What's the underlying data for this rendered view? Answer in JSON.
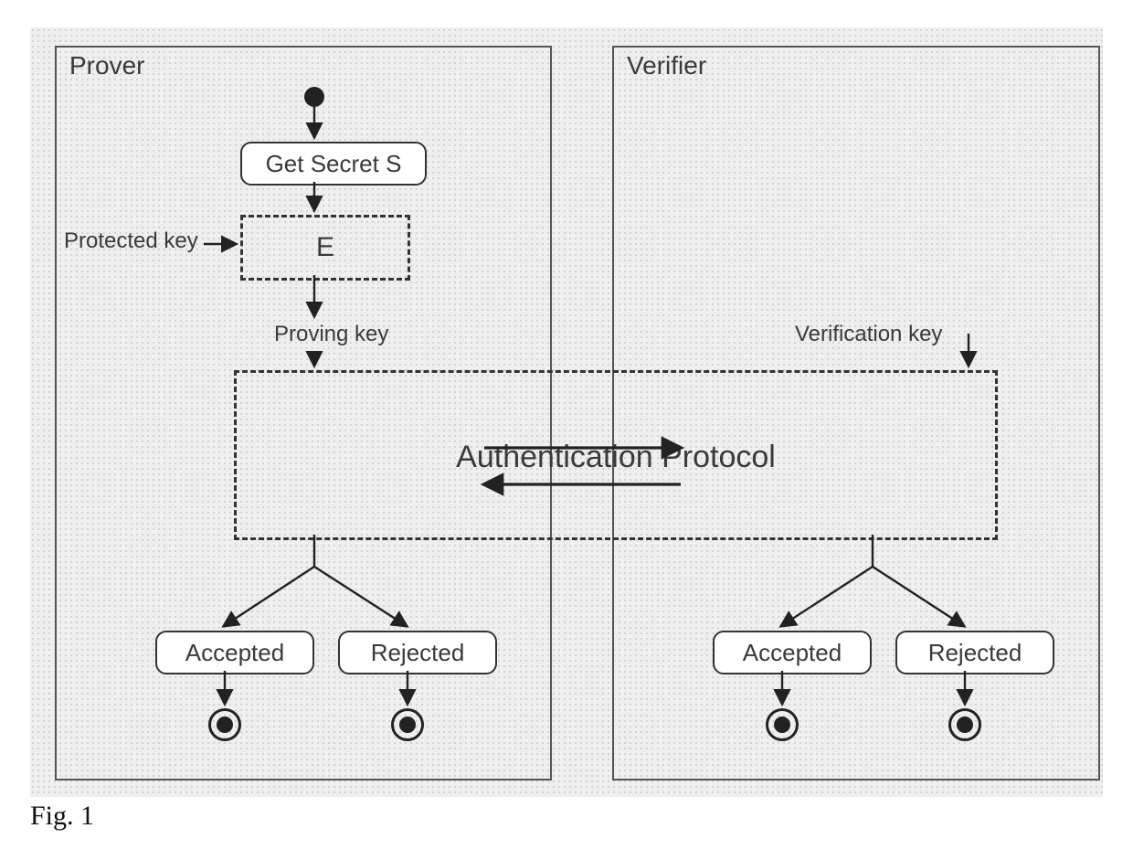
{
  "figure_caption": "Fig. 1",
  "prover": {
    "title": "Prover",
    "get_secret": "Get Secret S",
    "protected_key": "Protected key",
    "e_block": "E",
    "proving_key": "Proving key",
    "accepted": "Accepted",
    "rejected": "Rejected"
  },
  "verifier": {
    "title": "Verifier",
    "verification_key": "Verification key",
    "accepted": "Accepted",
    "rejected": "Rejected"
  },
  "auth": {
    "title": "Authentication Protocol"
  }
}
